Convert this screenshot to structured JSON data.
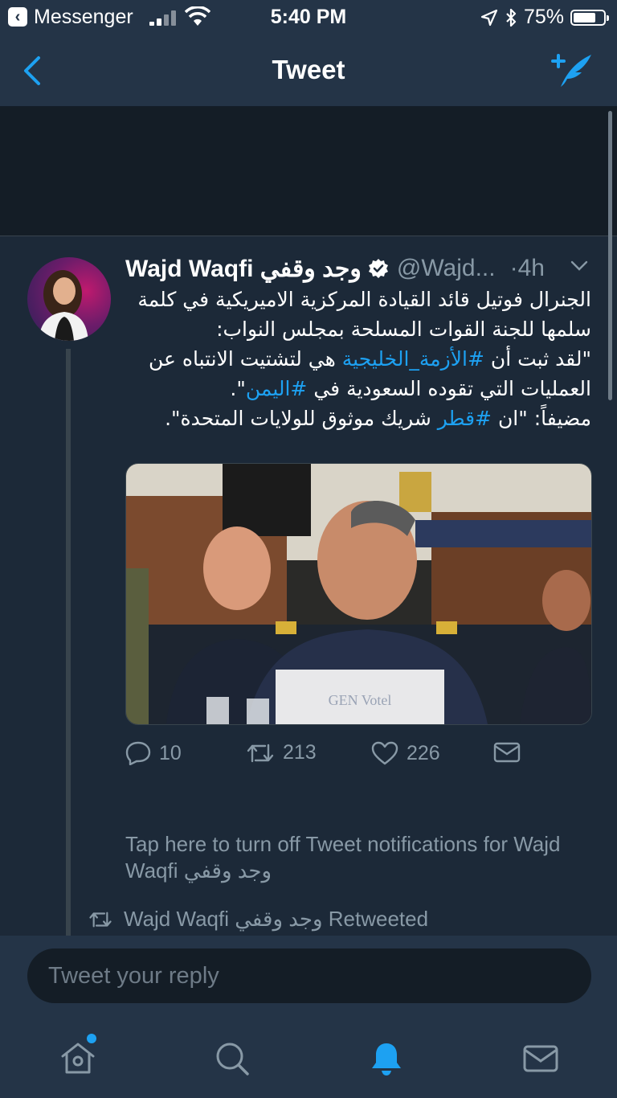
{
  "status_bar": {
    "back_app": "Messenger",
    "time": "5:40 PM",
    "battery": "75%",
    "battery_level": 0.75
  },
  "nav": {
    "title": "Tweet",
    "back_icon": "chevron-left-icon",
    "compose_icon": "compose-tweet-icon"
  },
  "tweet": {
    "name": "Wajd Waqfi وجد وقفي",
    "handle": "@Wajd...",
    "time": "·4h",
    "body": {
      "line1": "الجنرال فوتيل قائد القيادة المركزية الاميريكية في كلمة سلمها للجنة القوات المسلحة بمجلس النواب:",
      "q_start": "\"لقد ثبت أن ",
      "tag1": "#الأزمة_الخليجية",
      "q_mid": " هي لتشتيت الانتباه عن العمليات التي تقوده السعودية في ",
      "tag2": "#اليمن",
      "q_end": "\".",
      "line3_start": "مضيفاً: \"ان ",
      "tag3": "#قطر",
      "line3_end": " شريك موثوق للولايات المتحدة\"."
    },
    "media_caption": "GEN Votel",
    "actions": {
      "replies": "10",
      "retweets": "213",
      "likes": "226"
    },
    "accent": "#1da1f2"
  },
  "notification_text": "Tap here to turn off Tweet notifications for Wajd Waqfi وجد وقفي",
  "retweeted_text": "Wajd Waqfi وجد وقفي Retweeted",
  "reply": {
    "placeholder": "Tweet your reply"
  },
  "tabs": [
    "home-icon",
    "search-icon",
    "notifications-icon",
    "messages-icon"
  ]
}
